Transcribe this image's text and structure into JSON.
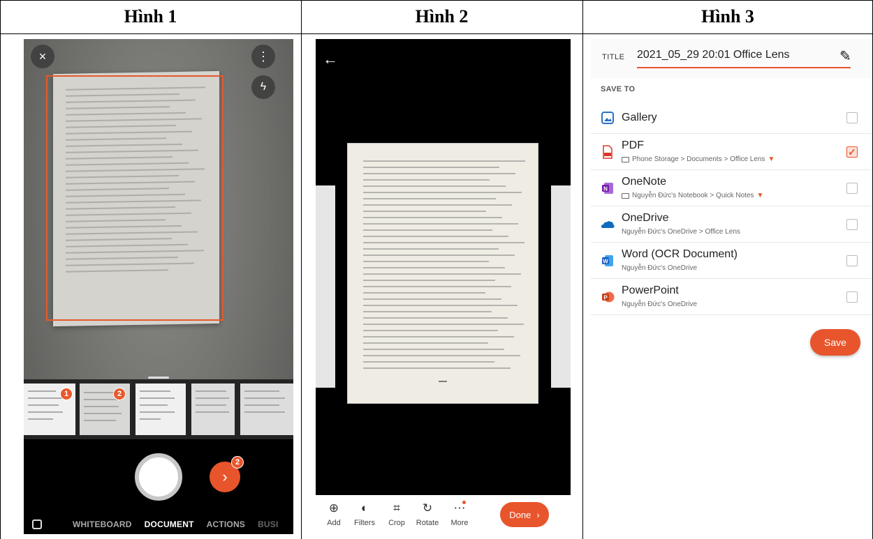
{
  "headers": [
    "Hình 1",
    "Hình 2",
    "Hình 3"
  ],
  "capture_screen": {
    "close_icon": "×",
    "more_icon": "⋮",
    "flash_icon": "ϟ",
    "thumbnail_badges": [
      "1",
      "2"
    ],
    "pending_count": "2",
    "modes": [
      "WHITEBOARD",
      "DOCUMENT",
      "ACTIONS",
      "BUSI"
    ],
    "active_mode": "DOCUMENT",
    "accent_color": "#e8552c"
  },
  "edit_screen": {
    "back_icon": "←",
    "tools": [
      {
        "label": "Add",
        "icon": "add-image-icon"
      },
      {
        "label": "Filters",
        "icon": "filters-icon"
      },
      {
        "label": "Crop",
        "icon": "crop-icon"
      },
      {
        "label": "Rotate",
        "icon": "rotate-icon"
      },
      {
        "label": "More",
        "icon": "more-icon"
      }
    ],
    "done_label": "Done"
  },
  "save_screen": {
    "title_label": "TITLE",
    "title_value": "2021_05_29 20:01 Office Lens",
    "save_to_label": "SAVE TO",
    "options": [
      {
        "name": "Gallery",
        "sub": "",
        "checked": false,
        "icon": "gallery-icon"
      },
      {
        "name": "PDF",
        "sub": "Phone Storage > Documents > Office Lens",
        "checked": true,
        "icon": "pdf-icon"
      },
      {
        "name": "OneNote",
        "sub": "Nguyễn Đức's Notebook > Quick Notes",
        "checked": false,
        "icon": "onenote-icon"
      },
      {
        "name": "OneDrive",
        "sub": "Nguyễn Đức's OneDrive > Office Lens",
        "checked": false,
        "icon": "onedrive-icon"
      },
      {
        "name": "Word (OCR Document)",
        "sub": "Nguyễn Đức's OneDrive",
        "checked": false,
        "icon": "word-icon"
      },
      {
        "name": "PowerPoint",
        "sub": "Nguyễn Đức's OneDrive",
        "checked": false,
        "icon": "powerpoint-icon"
      }
    ],
    "save_label": "Save"
  }
}
